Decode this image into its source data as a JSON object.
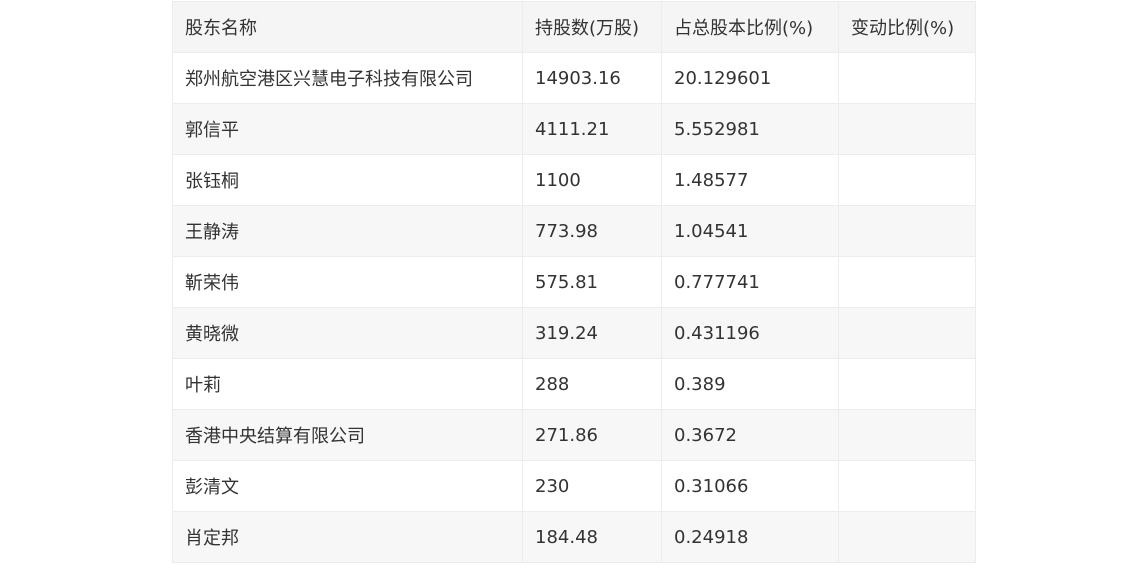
{
  "table": {
    "headers": [
      "股东名称",
      "持股数(万股)",
      "占总股本比例(%)",
      "变动比例(%)"
    ],
    "rows": [
      [
        "郑州航空港区兴慧电子科技有限公司",
        "14903.16",
        "20.129601",
        ""
      ],
      [
        "郭信平",
        "4111.21",
        "5.552981",
        ""
      ],
      [
        "张钰桐",
        "1100",
        "1.48577",
        ""
      ],
      [
        "王静涛",
        "773.98",
        "1.04541",
        ""
      ],
      [
        "靳荣伟",
        "575.81",
        "0.777741",
        ""
      ],
      [
        "黄晓微",
        "319.24",
        "0.431196",
        ""
      ],
      [
        "叶莉",
        "288",
        "0.389",
        ""
      ],
      [
        "香港中央结算有限公司",
        "271.86",
        "0.3672",
        ""
      ],
      [
        "彭清文",
        "230",
        "0.31066",
        ""
      ],
      [
        "肖定邦",
        "184.48",
        "0.24918",
        ""
      ]
    ]
  }
}
